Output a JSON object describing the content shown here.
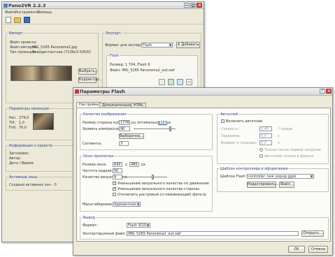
{
  "main_window": {
    "title": "Pano2VR 2.2.3",
    "menu": [
      "Файл",
      "Инструменты",
      "Помощь"
    ],
    "import": {
      "label": "Импорт",
      "rows": [
        {
          "k": "Файл проекта:",
          "v": ""
        },
        {
          "k": "Файл импорта:",
          "v": "IMG_5265 Panorama2.jpg"
        },
        {
          "k": "Тип проекции:",
          "v": "Эквидистантная (7136x3 035/0)"
        }
      ],
      "select_btn": "Выбрать...",
      "correct_btn": "Корректор..."
    },
    "export": {
      "label": "Экспорт",
      "format_label": "Формат для экспорта:",
      "format_value": "Flash",
      "add_btn": "Добавить",
      "flash_label": "Flash",
      "flash_lines": [
        "Размер: 1 704, Flash 9",
        "Файл: IMG_5265 Panorama2_out.swf"
      ]
    },
    "view": {
      "label": "Параметры проекции",
      "rows": [
        {
          "k": "Pan:",
          "v": "279,0"
        },
        {
          "k": "Tilt:",
          "v": "1,0"
        },
        {
          "k": "FoV:",
          "v": "70,0"
        }
      ]
    },
    "info": {
      "label": "Информация о проекте",
      "rows": [
        "Заголовок:",
        "Автор:",
        "Дата / Время:"
      ]
    },
    "hotspots": {
      "label": "Активные зоны",
      "text": "Создано активных зон - 0"
    }
  },
  "flash_dialog": {
    "title": "Параметры Flash",
    "tabs": [
      "Настройки",
      "Дополнительно",
      "HTML"
    ],
    "quality": {
      "label": "Качество изображения",
      "cube_label": "Размер стороны кубa:",
      "cube_value": "1776",
      "px": "px",
      "optimal_label": "оптимально:",
      "optimal_value": "1187",
      "optimal_px": "px",
      "compression_label": "Уровень компрессии:",
      "compression_value": "90",
      "choose_btn": "Выборочно...",
      "segments_label": "Сегменты:",
      "segments_value": "3"
    },
    "window": {
      "label": "Окно просмотра",
      "size_label": "Размер окна:",
      "width": "640",
      "x": "x",
      "height": "480",
      "px": "px",
      "fps_label": "Частота кадров:",
      "fps_value": "50",
      "quality_label": "Качество визуализации:",
      "quality_value": "9",
      "checks": [
        "Уменьшение визуального качества по движению",
        "Уменьшение визуального качества стороны",
        "Отключить растровый (сглаживающий) фильтр"
      ],
      "scale_label": "Масштабирование:",
      "scale_value": "Адекватное"
    },
    "autoplay": {
      "label": "Автоплей",
      "enable_label": "Включить автоплей",
      "speed_label": "Скорость:",
      "speed_value": "0,40",
      "speed_unit": "°/ кадре",
      "delay_label": "Задержка:",
      "delay_value": "5,0",
      "delay_unit": "s",
      "return_label": "Возврат к позиции:",
      "return_value": "0,0",
      "return_unit": "s",
      "radio1": "Только после первой загрузки",
      "radio2": "Автоплей только в фокусе"
    },
    "skin": {
      "label": "Шаблон контроллера и оформления",
      "template_label": "Шаблон Flash 9:",
      "template_value": "controller_new_popup.ggsk",
      "edit_btn": "Редактировать...",
      "file_btn": "Файл..."
    },
    "output": {
      "label": "Вывод",
      "format_label": "Формат:",
      "format_value": "Flash 9/10",
      "file_label": "Экспортируемый файл:",
      "file_value": "IMG_5265 Panorama2_out.swf",
      "open_btn": "Открыть..."
    },
    "ok_btn": "OK",
    "cancel_btn": "Отмена"
  }
}
